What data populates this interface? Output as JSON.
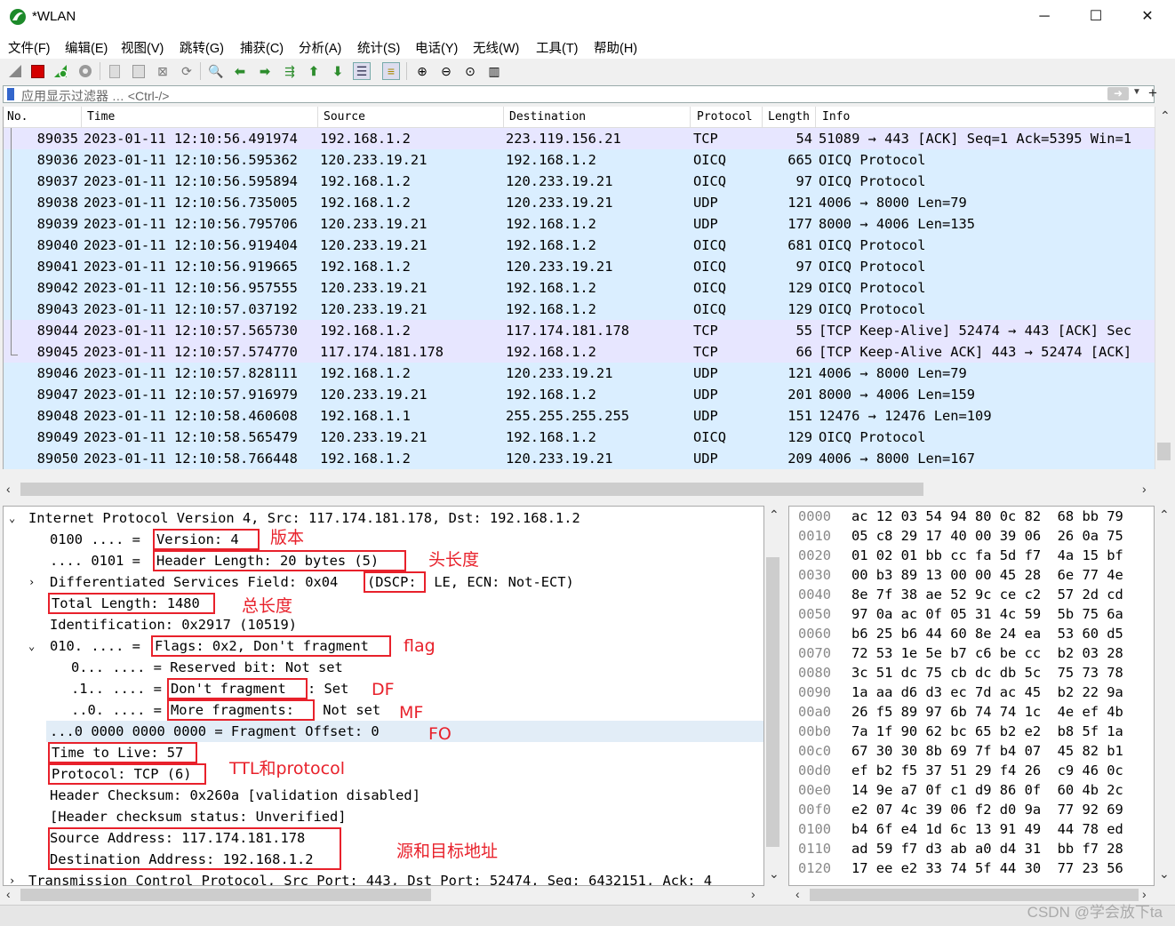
{
  "window": {
    "title": "*WLAN",
    "minimize": "─",
    "maximize": "☐",
    "close": "✕"
  },
  "menu": [
    "文件(F)",
    "编辑(E)",
    "视图(V)",
    "跳转(G)",
    "捕获(C)",
    "分析(A)",
    "统计(S)",
    "电话(Y)",
    "无线(W)",
    "工具(T)",
    "帮助(H)"
  ],
  "toolbar_icons": [
    "shark-fin-icon",
    "stop-icon",
    "restart-icon",
    "options-gear-icon",
    "open-file-icon",
    "save-file-icon",
    "close-file-icon",
    "reload-icon",
    "find-icon",
    "back-arrow-icon",
    "forward-arrow-icon",
    "go-to-packet-icon",
    "first-packet-icon",
    "last-packet-icon",
    "autoscroll-icon",
    "colorize-icon",
    "zoom-in-icon",
    "zoom-out-icon",
    "zoom-normal-icon",
    "resize-columns-icon"
  ],
  "filter": {
    "placeholder": "应用显示过滤器 … <Ctrl-/>",
    "apply_icon": "arrow-right-icon",
    "add_icon": "plus-icon"
  },
  "columns": [
    "No.",
    "Time",
    "Source",
    "Destination",
    "Protocol",
    "Length",
    "Info"
  ],
  "packets": [
    {
      "no": "89035",
      "time": "2023-01-11 12:10:56.491974",
      "src": "192.168.1.2",
      "dst": "223.119.156.21",
      "proto": "TCP",
      "len": "54",
      "info": "51089 → 443 [ACK] Seq=1 Ack=5395 Win=1",
      "color": "#e7e6ff"
    },
    {
      "no": "89036",
      "time": "2023-01-11 12:10:56.595362",
      "src": "120.233.19.21",
      "dst": "192.168.1.2",
      "proto": "OICQ",
      "len": "665",
      "info": "OICQ Protocol",
      "color": "#daeeff"
    },
    {
      "no": "89037",
      "time": "2023-01-11 12:10:56.595894",
      "src": "192.168.1.2",
      "dst": "120.233.19.21",
      "proto": "OICQ",
      "len": "97",
      "info": "OICQ Protocol",
      "color": "#daeeff"
    },
    {
      "no": "89038",
      "time": "2023-01-11 12:10:56.735005",
      "src": "192.168.1.2",
      "dst": "120.233.19.21",
      "proto": "UDP",
      "len": "121",
      "info": "4006 → 8000 Len=79",
      "color": "#daeeff"
    },
    {
      "no": "89039",
      "time": "2023-01-11 12:10:56.795706",
      "src": "120.233.19.21",
      "dst": "192.168.1.2",
      "proto": "UDP",
      "len": "177",
      "info": "8000 → 4006 Len=135",
      "color": "#daeeff"
    },
    {
      "no": "89040",
      "time": "2023-01-11 12:10:56.919404",
      "src": "120.233.19.21",
      "dst": "192.168.1.2",
      "proto": "OICQ",
      "len": "681",
      "info": "OICQ Protocol",
      "color": "#daeeff"
    },
    {
      "no": "89041",
      "time": "2023-01-11 12:10:56.919665",
      "src": "192.168.1.2",
      "dst": "120.233.19.21",
      "proto": "OICQ",
      "len": "97",
      "info": "OICQ Protocol",
      "color": "#daeeff"
    },
    {
      "no": "89042",
      "time": "2023-01-11 12:10:56.957555",
      "src": "120.233.19.21",
      "dst": "192.168.1.2",
      "proto": "OICQ",
      "len": "129",
      "info": "OICQ Protocol",
      "color": "#daeeff"
    },
    {
      "no": "89043",
      "time": "2023-01-11 12:10:57.037192",
      "src": "120.233.19.21",
      "dst": "192.168.1.2",
      "proto": "OICQ",
      "len": "129",
      "info": "OICQ Protocol",
      "color": "#daeeff"
    },
    {
      "no": "89044",
      "time": "2023-01-11 12:10:57.565730",
      "src": "192.168.1.2",
      "dst": "117.174.181.178",
      "proto": "TCP",
      "len": "55",
      "info": "[TCP Keep-Alive] 52474 → 443 [ACK] Sec",
      "color": "#e7e6ff"
    },
    {
      "no": "89045",
      "time": "2023-01-11 12:10:57.574770",
      "src": "117.174.181.178",
      "dst": "192.168.1.2",
      "proto": "TCP",
      "len": "66",
      "info": "[TCP Keep-Alive ACK] 443 → 52474 [ACK]",
      "color": "#e7e6ff"
    },
    {
      "no": "89046",
      "time": "2023-01-11 12:10:57.828111",
      "src": "192.168.1.2",
      "dst": "120.233.19.21",
      "proto": "UDP",
      "len": "121",
      "info": "4006 → 8000 Len=79",
      "color": "#daeeff"
    },
    {
      "no": "89047",
      "time": "2023-01-11 12:10:57.916979",
      "src": "120.233.19.21",
      "dst": "192.168.1.2",
      "proto": "UDP",
      "len": "201",
      "info": "8000 → 4006 Len=159",
      "color": "#daeeff"
    },
    {
      "no": "89048",
      "time": "2023-01-11 12:10:58.460608",
      "src": "192.168.1.1",
      "dst": "255.255.255.255",
      "proto": "UDP",
      "len": "151",
      "info": "12476 → 12476 Len=109",
      "color": "#daeeff"
    },
    {
      "no": "89049",
      "time": "2023-01-11 12:10:58.565479",
      "src": "120.233.19.21",
      "dst": "192.168.1.2",
      "proto": "OICQ",
      "len": "129",
      "info": "OICQ Protocol",
      "color": "#daeeff"
    },
    {
      "no": "89050",
      "time": "2023-01-11 12:10:58.766448",
      "src": "192.168.1.2",
      "dst": "120.233.19.21",
      "proto": "UDP",
      "len": "209",
      "info": "4006 → 8000 Len=167",
      "color": "#daeeff"
    }
  ],
  "detail": {
    "ip_header": "Internet Protocol Version 4, Src: 117.174.181.178, Dst: 192.168.1.2",
    "version_bits": "0100 .... = ",
    "version": "Version: 4",
    "hlen_bits": ".... 0101 = ",
    "hlen": "Header Length: 20 bytes (5)",
    "dsf_pre": "Differentiated Services Field: 0x04 ",
    "dsf_box": "(DSCP:",
    "dsf_post": " LE, ECN: Not-ECT)",
    "total_length": "Total Length: 1480",
    "identification": "Identification: 0x2917 (10519)",
    "flags_bits": "010. .... = ",
    "flags": "Flags: 0x2, Don't fragment",
    "reserved": "0... .... = Reserved bit: Not set",
    "df_bits": ".1.. .... = ",
    "df": "Don't fragment",
    "df_post": ": Set",
    "mf_bits": "..0. .... = ",
    "mf": "More fragments:",
    "mf_post": " Not set",
    "frag_offset": "...0 0000 0000 0000 = Fragment Offset: 0",
    "ttl": "Time to Live: 57",
    "protocol": "Protocol: TCP (6)",
    "checksum": "Header Checksum: 0x260a [validation disabled]",
    "checksum_status": "[Header checksum status: Unverified]",
    "src_addr": "Source Address: 117.174.181.178",
    "dst_addr": "Destination Address: 192.168.1.2",
    "tcp_header": "Transmission Control Protocol, Src Port: 443, Dst Port: 52474, Seq: 6432151, Ack: 4"
  },
  "annotations": {
    "version": "版本",
    "hlen": "头长度",
    "total": "总长度",
    "flag": "flag",
    "df": "DF",
    "mf": "MF",
    "fo": "FO",
    "ttl": "TTL和protocol",
    "addr": "源和目标地址"
  },
  "hex": [
    {
      "off": "0000",
      "bytes": "ac 12 03 54 94 80 0c 82  68 bb 79"
    },
    {
      "off": "0010",
      "bytes": "05 c8 29 17 40 00 39 06  26 0a 75"
    },
    {
      "off": "0020",
      "bytes": "01 02 01 bb cc fa 5d f7  4a 15 bf"
    },
    {
      "off": "0030",
      "bytes": "00 b3 89 13 00 00 45 28  6e 77 4e"
    },
    {
      "off": "0040",
      "bytes": "8e 7f 38 ae 52 9c ce c2  57 2d cd"
    },
    {
      "off": "0050",
      "bytes": "97 0a ac 0f 05 31 4c 59  5b 75 6a"
    },
    {
      "off": "0060",
      "bytes": "b6 25 b6 44 60 8e 24 ea  53 60 d5"
    },
    {
      "off": "0070",
      "bytes": "72 53 1e 5e b7 c6 be cc  b2 03 28"
    },
    {
      "off": "0080",
      "bytes": "3c 51 dc 75 cb dc db 5c  75 73 78"
    },
    {
      "off": "0090",
      "bytes": "1a aa d6 d3 ec 7d ac 45  b2 22 9a"
    },
    {
      "off": "00a0",
      "bytes": "26 f5 89 97 6b 74 74 1c  4e ef 4b"
    },
    {
      "off": "00b0",
      "bytes": "7a 1f 90 62 bc 65 b2 e2  b8 5f 1a"
    },
    {
      "off": "00c0",
      "bytes": "67 30 30 8b 69 7f b4 07  45 82 b1"
    },
    {
      "off": "00d0",
      "bytes": "ef b2 f5 37 51 29 f4 26  c9 46 0c"
    },
    {
      "off": "00e0",
      "bytes": "14 9e a7 0f c1 d9 86 0f  60 4b 2c"
    },
    {
      "off": "00f0",
      "bytes": "e2 07 4c 39 06 f2 d0 9a  77 92 69"
    },
    {
      "off": "0100",
      "bytes": "b4 6f e4 1d 6c 13 91 49  44 78 ed"
    },
    {
      "off": "0110",
      "bytes": "ad 59 f7 d3 ab a0 d4 31  bb f7 28"
    },
    {
      "off": "0120",
      "bytes": "17 ee e2 33 74 5f 44 30  77 23 56"
    }
  ],
  "watermark": "CSDN @学会放下ta"
}
